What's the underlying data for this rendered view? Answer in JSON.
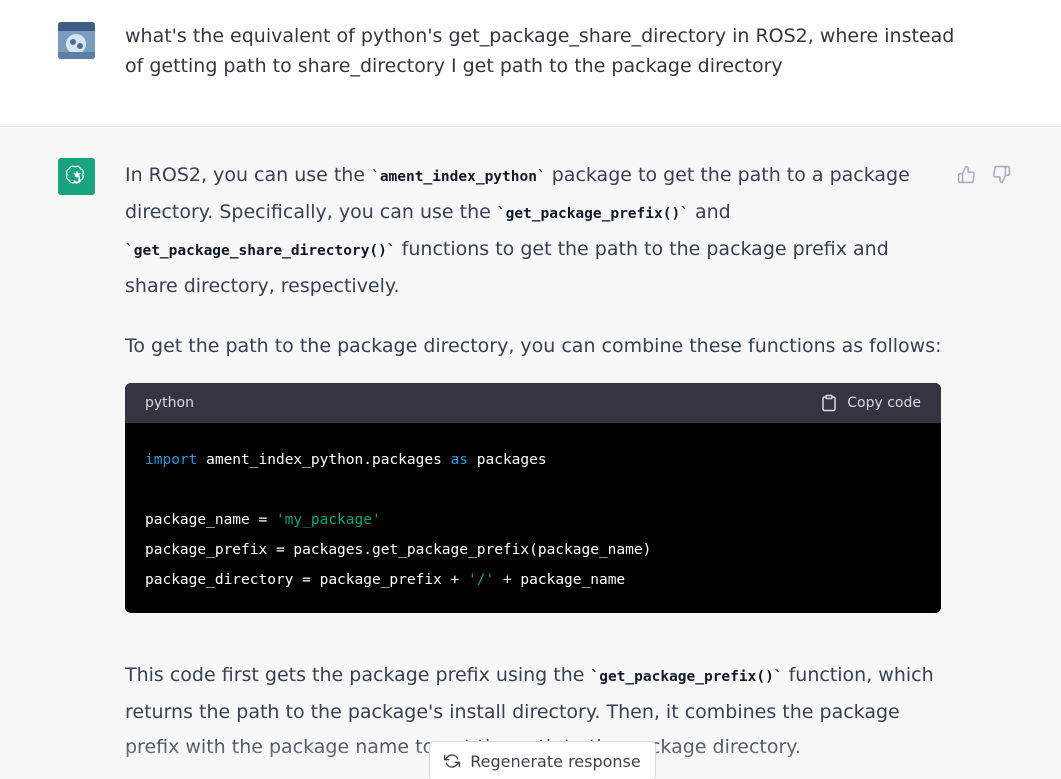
{
  "user_message": {
    "text": "what's the equivalent of python's get_package_share_directory in ROS2, where instead of getting path to share_directory I get path to the package directory"
  },
  "assistant_message": {
    "p1": {
      "t1": "In ROS2, you can use the ",
      "c1": "`ament_index_python`",
      "t2": " package to get the path to a package directory. Specifically, you can use the ",
      "c2": "`get_package_prefix()`",
      "t3": " and ",
      "c3": "`get_package_share_directory()`",
      "t4": " functions to get the path to the package prefix and share directory, respectively."
    },
    "p2": "To get the path to the package directory, you can combine these functions as follows:",
    "code": {
      "language": "python",
      "copy_label": "Copy code",
      "line1": {
        "kw1": "import",
        "t1": " ament_index_python.packages ",
        "kw2": "as",
        "t2": " packages"
      },
      "line2": {
        "t1": "package_name = ",
        "s1": "'my_package'"
      },
      "line3": {
        "t1": "package_prefix = packages.get_package_prefix(package_name)"
      },
      "line4": {
        "t1": "package_directory = package_prefix + ",
        "s1": "'/'",
        "t2": " + package_name"
      }
    },
    "p3": {
      "t1": "This code first gets the package prefix using the ",
      "c1": "`get_package_prefix()`",
      "t2": " function, which returns the path to the package's install directory. Then, it combines the package prefix with the package name to get the path to the package directory."
    }
  },
  "actions": {
    "regenerate_label": "Regenerate response"
  },
  "colors": {
    "assistant_bg": "#f7f7f8",
    "gpt_avatar": "#19a37f",
    "code_bg": "#000000",
    "code_header": "#343541",
    "keyword": "#2e95d3",
    "string": "#00a67d"
  }
}
